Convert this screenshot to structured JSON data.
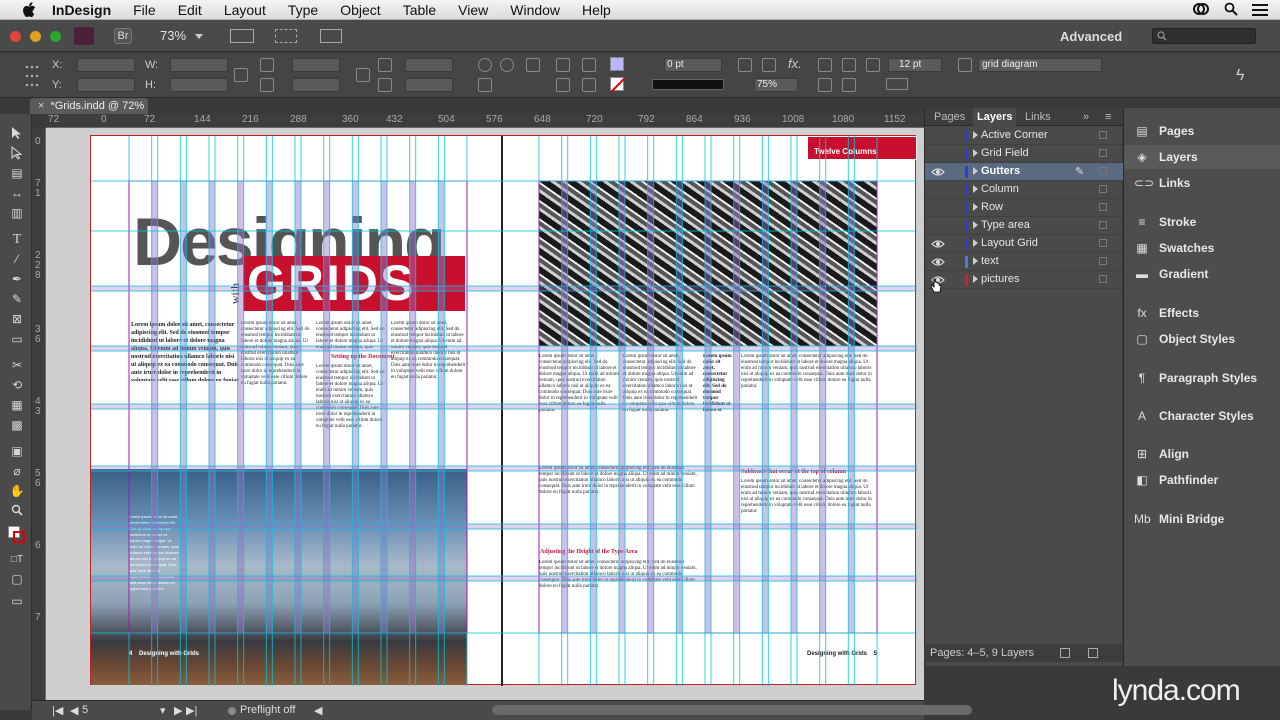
{
  "menubar": {
    "app": "InDesign",
    "items": [
      "File",
      "Edit",
      "Layout",
      "Type",
      "Object",
      "Table",
      "View",
      "Window",
      "Help"
    ]
  },
  "appbar": {
    "bridge_label": "Br",
    "zoom": "73%",
    "workspace": "Advanced"
  },
  "control": {
    "x_label": "X:",
    "y_label": "Y:",
    "w_label": "W:",
    "h_label": "H:",
    "stroke_value": "0 pt",
    "opacity": "75%",
    "size_value": "12 pt",
    "object_style": "grid diagram"
  },
  "doc_tab": "*Grids.indd @ 72%",
  "ruler": {
    "marks": [
      "72",
      "0",
      "72",
      "144",
      "216",
      "288",
      "360",
      "432",
      "504",
      "576",
      "648",
      "720",
      "792",
      "864",
      "936",
      "1008",
      "1080",
      "1152"
    ],
    "vmarks": [
      "0",
      "7",
      "1",
      "2",
      "2",
      "8",
      "3",
      "6",
      "4",
      "3",
      "5",
      "6",
      "6",
      "7"
    ]
  },
  "document": {
    "title_big": "Designing",
    "title_with": "with",
    "title_grids": "GRIDS",
    "red_tag": "Twelve Columns",
    "subhead1": "Setting up the Document",
    "subhead2": "Adjusting the Height of the Type Area",
    "subhead3": "Subheads that occur at the top of column",
    "folio_left": "4    Designing with Grids",
    "folio_right": "Designing with Grids    5",
    "lorem": "Lorem ipsum dolor sit amet, consectetur adipiscing elit. Sed do eiusmod tempor incididunt ut labore et dolore magna aliqua. Ut enim ad minim veniam, quis nostrud exercitation ullamco laboris nisi ut aliquip ex ea commodo consequat. Duis aute irure dolor in reprehenderit in voluptate velit esse cillum dolore eu fugiat nulla pariatur."
  },
  "panel": {
    "tabs": [
      "Pages",
      "Layers",
      "Links"
    ],
    "layers": [
      {
        "name": "Active Corner",
        "color": "#2b3de0",
        "eye": false,
        "selected": false
      },
      {
        "name": "Grid Field",
        "color": "#2b3de0",
        "eye": false,
        "selected": false
      },
      {
        "name": "Gutters",
        "color": "#2b3de0",
        "eye": true,
        "selected": true
      },
      {
        "name": "Column",
        "color": "#2b3de0",
        "eye": false,
        "selected": false
      },
      {
        "name": "Row",
        "color": "#2b3de0",
        "eye": false,
        "selected": false
      },
      {
        "name": "Type area",
        "color": "#2b3de0",
        "eye": false,
        "selected": false
      },
      {
        "name": "Layout Grid",
        "color": "#2b3de0",
        "eye": true,
        "selected": false
      },
      {
        "name": "text",
        "color": "#4a7de0",
        "eye": true,
        "selected": false
      },
      {
        "name": "pictures",
        "color": "#d62020",
        "eye": true,
        "selected": false
      }
    ],
    "footer": "Pages: 4–5, 9 Layers"
  },
  "dock": {
    "items": [
      "Pages",
      "Layers",
      "Links",
      "Stroke",
      "Swatches",
      "Gradient",
      "Effects",
      "Object Styles",
      "Paragraph Styles",
      "Character Styles",
      "Align",
      "Pathfinder",
      "Mini Bridge"
    ]
  },
  "status": {
    "page": "5",
    "preflight": "Preflight off"
  },
  "watermark": "lynda.com"
}
